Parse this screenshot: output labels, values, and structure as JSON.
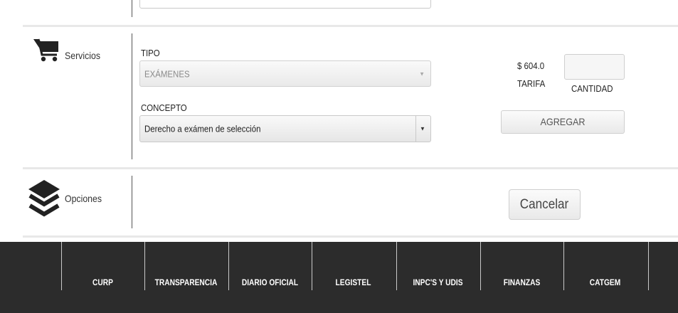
{
  "servicios": {
    "label": "Servicios",
    "tipo_label": "TIPO",
    "tipo_value": "EXÁMENES",
    "concepto_label": "CONCEPTO",
    "concepto_value": "Derecho a exámen de selección",
    "price": "$ 604.0",
    "tarifa_label": "TARIFA",
    "cantidad_label": "CANTIDAD",
    "cantidad_value": "",
    "agregar_label": "AGREGAR"
  },
  "opciones": {
    "label": "Opciones",
    "cancel_label": "Cancelar"
  },
  "footer": {
    "links": [
      "CURP",
      "TRANSPARENCIA",
      "DIARIO OFICIAL",
      "LEGISTEL",
      "INPC'S Y UDIS",
      "FINANZAS",
      "CATGEM"
    ]
  },
  "icons": {
    "cart": "cart-icon",
    "layers": "layers-icon"
  },
  "colors": {
    "footer_bg": "#2c2c2c",
    "icon": "#222222"
  }
}
